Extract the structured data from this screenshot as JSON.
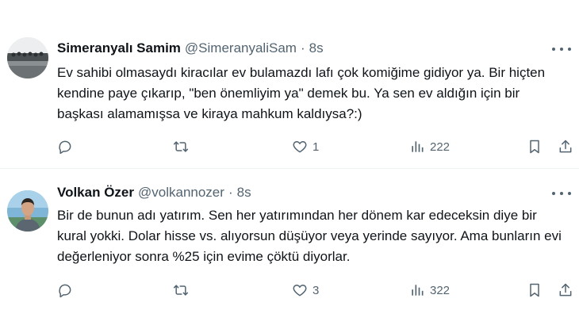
{
  "tweets": [
    {
      "name": "Simeranyalı Samim",
      "handle": "@SimeranyaliSam",
      "separator": "·",
      "time": "8s",
      "text": "Ev sahibi olmasaydı kiracılar ev bulamazdı lafı çok komiğime gidiyor ya.  Bir hiçten kendine paye çıkarıp, \"ben önemliyim ya\" demek bu. Ya sen ev aldığın için bir başkası alamamışsa ve kiraya mahkum kaldıysa?:)",
      "reply_count": "",
      "retweet_count": "",
      "like_count": "1",
      "view_count": "222",
      "avatar_icon": "group-photo-avatar"
    },
    {
      "name": "Volkan Özer",
      "handle": "@volkannozer",
      "separator": "·",
      "time": "8s",
      "text": "Bir de bunun adı yatırım. Sen her yatırımından her dönem kar edeceksin diye bir kural yokki. Dolar hisse vs. alıyorsun düşüyor veya yerinde sayıyor. Ama bunların evi değerleniyor sonra %25 için evime çöktü diyorlar.",
      "reply_count": "",
      "retweet_count": "",
      "like_count": "3",
      "view_count": "322",
      "avatar_icon": "person-photo-avatar"
    }
  ],
  "icons": {
    "reply": "reply-icon",
    "retweet": "retweet-icon",
    "like": "heart-icon",
    "views": "views-icon",
    "bookmark": "bookmark-icon",
    "share": "share-icon",
    "more": "more-icon"
  },
  "colors": {
    "primary_text": "#0f1419",
    "secondary_text": "#536471",
    "divider": "#eff3f4"
  }
}
